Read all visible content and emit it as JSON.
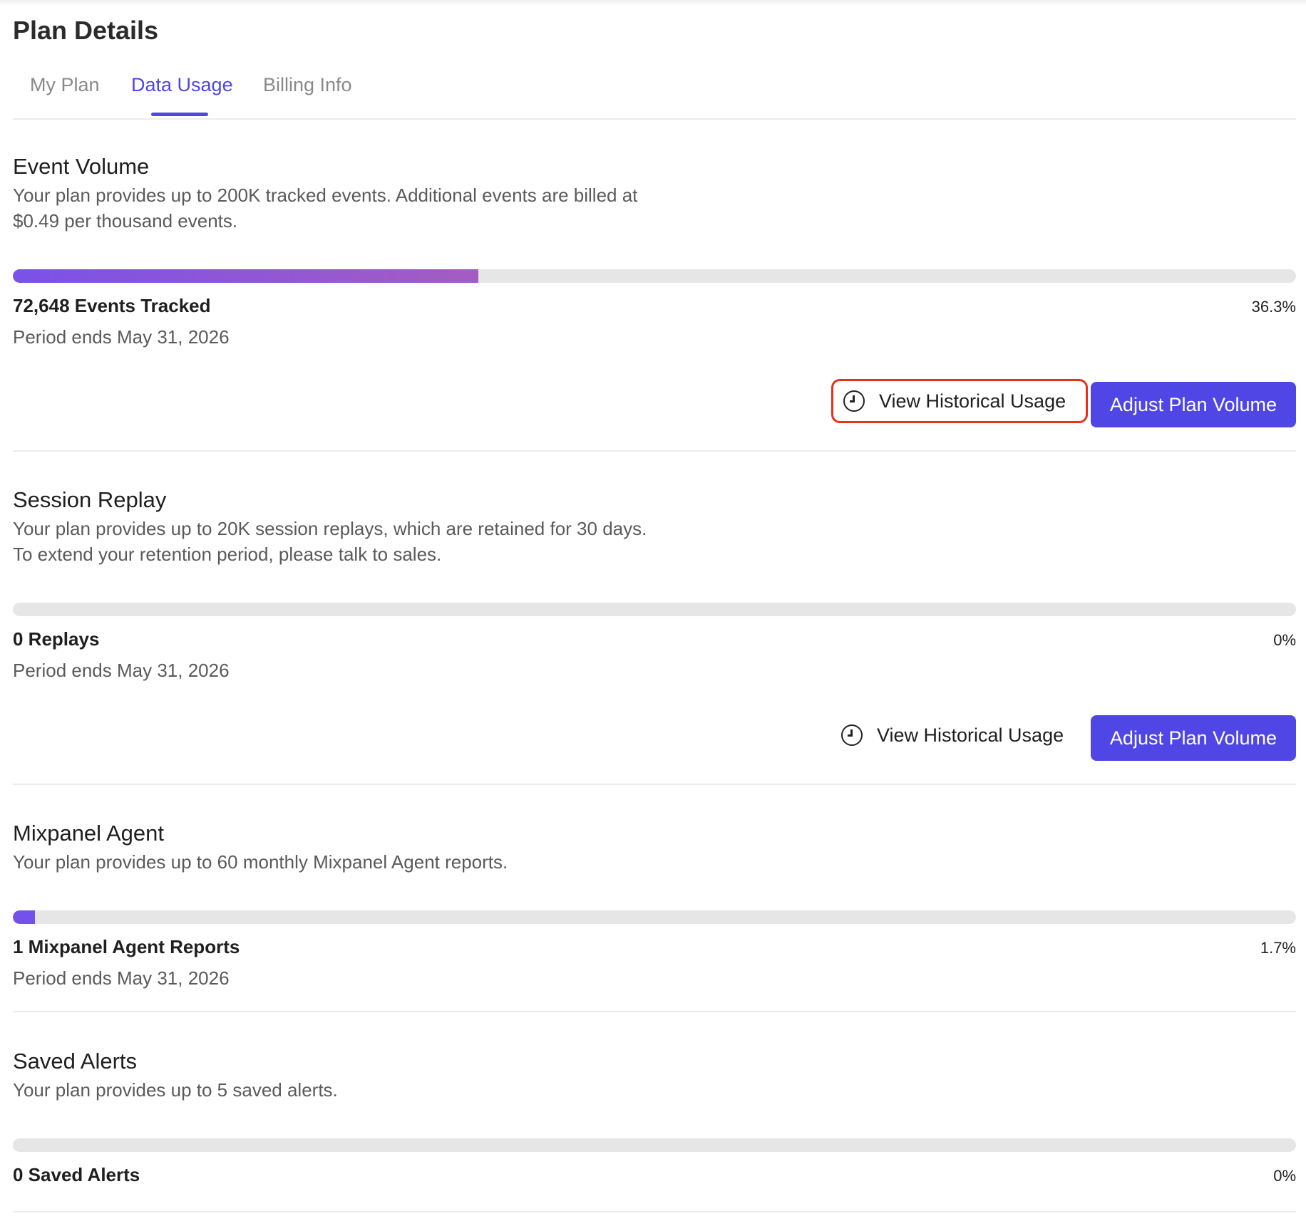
{
  "page_title": "Plan Details",
  "tabs": [
    {
      "label": "My Plan",
      "active": false
    },
    {
      "label": "Data Usage",
      "active": true
    },
    {
      "label": "Billing Info",
      "active": false
    }
  ],
  "colors": {
    "accent": "#4f46e5",
    "highlight": "#e8321e",
    "track": "#e7e6e6"
  },
  "sections": [
    {
      "title": "Event Volume",
      "description": "Your plan provides up to 200K tracked events. Additional events are billed at $0.49 per thousand events.",
      "usage_fraction": 0.363,
      "count": "72,648 Events Tracked",
      "percent": "36.3%",
      "period": "Period ends May 31, 2026",
      "historical_label": "View Historical Usage",
      "adjust_label": "Adjust Plan Volume"
    },
    {
      "title": "Session Replay",
      "description": "Your plan provides up to 20K session replays, which are retained for 30 days. To extend your retention period, please talk to sales.",
      "usage_fraction": 0,
      "count": "0 Replays",
      "percent": "0%",
      "period": "Period ends May 31, 2026",
      "historical_label": "View Historical Usage",
      "adjust_label": "Adjust Plan Volume"
    },
    {
      "title": "Mixpanel Agent",
      "description": "Your plan provides up to 60 monthly Mixpanel Agent reports.",
      "usage_fraction": 0.017,
      "count": "1 Mixpanel Agent Reports",
      "percent": "1.7%",
      "period": "Period ends May 31, 2026"
    },
    {
      "title": "Saved Alerts",
      "description": "Your plan provides up to 5 saved alerts.",
      "usage_fraction": 0,
      "count": "0 Saved Alerts",
      "percent": "0%"
    }
  ]
}
